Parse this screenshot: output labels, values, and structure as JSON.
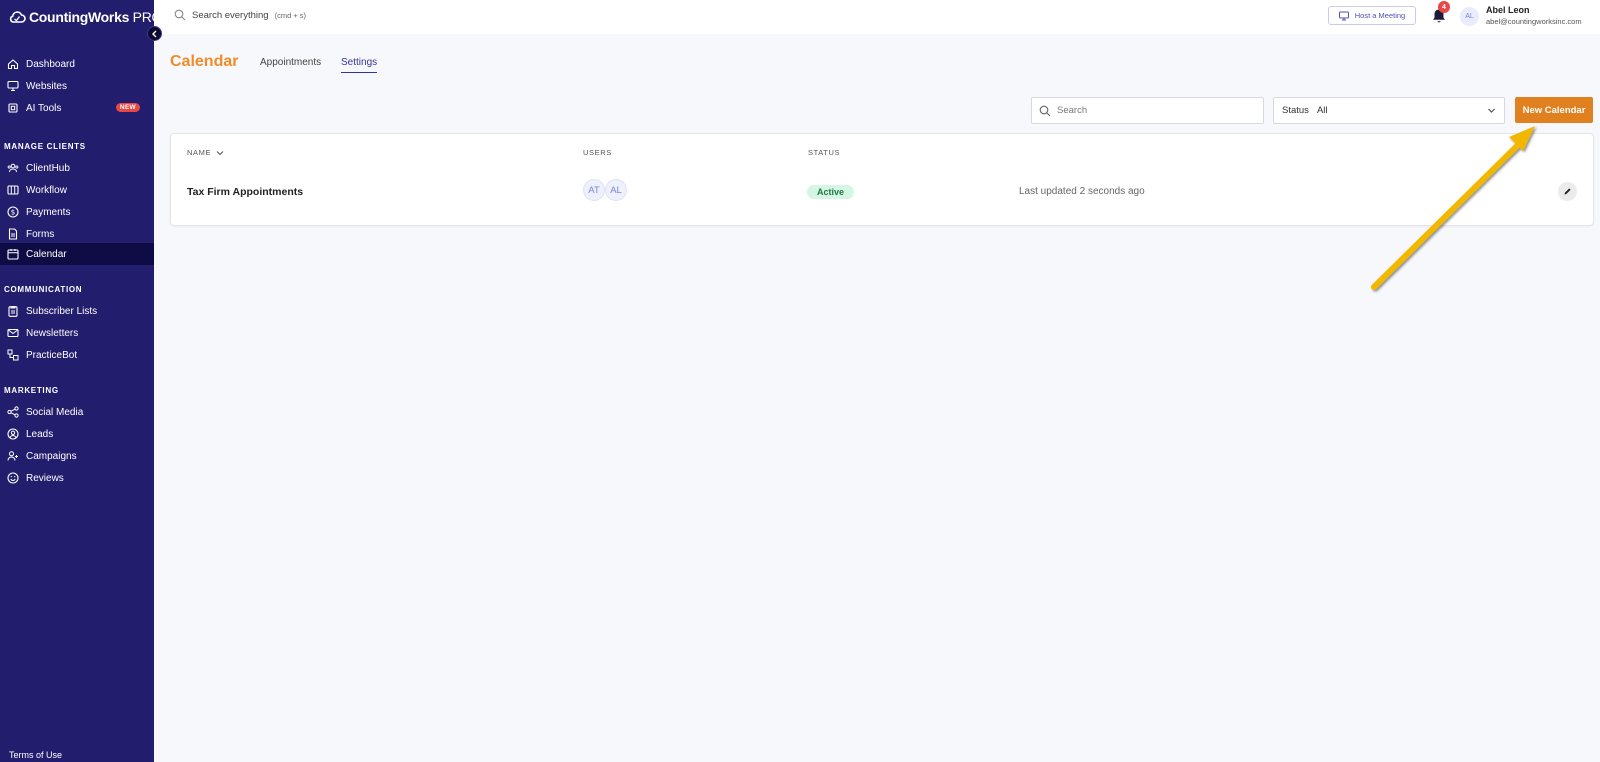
{
  "app": {
    "brand": "CountingWorks",
    "brand_suffix": " PRO"
  },
  "sidebar": {
    "top_items": [
      {
        "label": "Dashboard",
        "icon": "home-icon"
      },
      {
        "label": "Websites",
        "icon": "monitor-icon"
      },
      {
        "label": "AI Tools",
        "icon": "chip-icon",
        "badge": "NEW"
      }
    ],
    "sections": [
      {
        "title": "MANAGE CLIENTS",
        "items": [
          {
            "label": "ClientHub",
            "icon": "users-icon"
          },
          {
            "label": "Workflow",
            "icon": "columns-icon"
          },
          {
            "label": "Payments",
            "icon": "dollar-icon"
          },
          {
            "label": "Forms",
            "icon": "document-icon"
          },
          {
            "label": "Calendar",
            "icon": "calendar-icon",
            "active": true
          }
        ]
      },
      {
        "title": "COMMUNICATION",
        "items": [
          {
            "label": "Subscriber Lists",
            "icon": "clipboard-icon"
          },
          {
            "label": "Newsletters",
            "icon": "mail-icon"
          },
          {
            "label": "PracticeBot",
            "icon": "bot-icon"
          }
        ]
      },
      {
        "title": "MARKETING",
        "items": [
          {
            "label": "Social Media",
            "icon": "share-icon"
          },
          {
            "label": "Leads",
            "icon": "user-circle-icon"
          },
          {
            "label": "Campaigns",
            "icon": "user-plus-icon"
          },
          {
            "label": "Reviews",
            "icon": "smile-icon"
          }
        ]
      }
    ],
    "footer_link": "Terms of Use"
  },
  "topbar": {
    "search_label": "Search everything",
    "search_hint": "(cmd + s)",
    "host_meeting": "Host a Meeting",
    "notification_count": "4",
    "user_initials": "AL",
    "user_name": "Abel Leon",
    "user_email": "abel@countingworksinc.com"
  },
  "page": {
    "title": "Calendar",
    "tabs": [
      {
        "label": "Appointments",
        "active": false
      },
      {
        "label": "Settings",
        "active": true
      }
    ],
    "search_placeholder": "Search",
    "status_label": "Status",
    "status_value": "All",
    "new_button": "New Calendar"
  },
  "table": {
    "columns": {
      "name": "NAME",
      "users": "USERS",
      "status": "STATUS"
    },
    "rows": [
      {
        "name": "Tax Firm Appointments",
        "users": [
          "AT",
          "AL"
        ],
        "status": "Active",
        "updated": "Last updated 2 seconds ago"
      }
    ]
  },
  "colors": {
    "sidebar_bg": "#231d6d",
    "accent_orange": "#e1801e",
    "title_orange": "#f08c2a",
    "active_tab": "#33349a",
    "annotation_arrow": "#f2b705"
  }
}
